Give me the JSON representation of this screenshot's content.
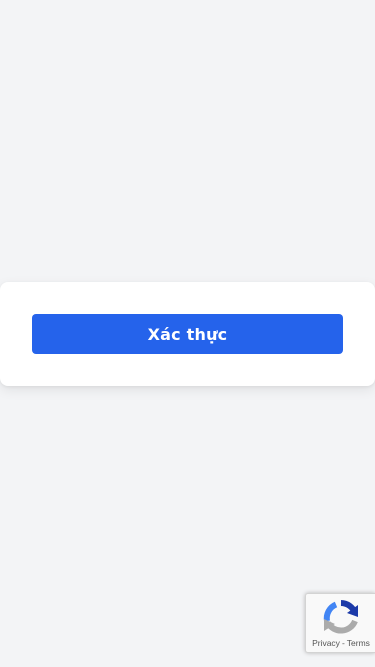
{
  "card": {
    "verify_label": "Xác thực"
  },
  "recaptcha": {
    "privacy_label": "Privacy",
    "separator": "-",
    "terms_label": "Terms"
  },
  "colors": {
    "background": "#f3f4f6",
    "primary_button": "#2563eb",
    "card": "#ffffff"
  }
}
